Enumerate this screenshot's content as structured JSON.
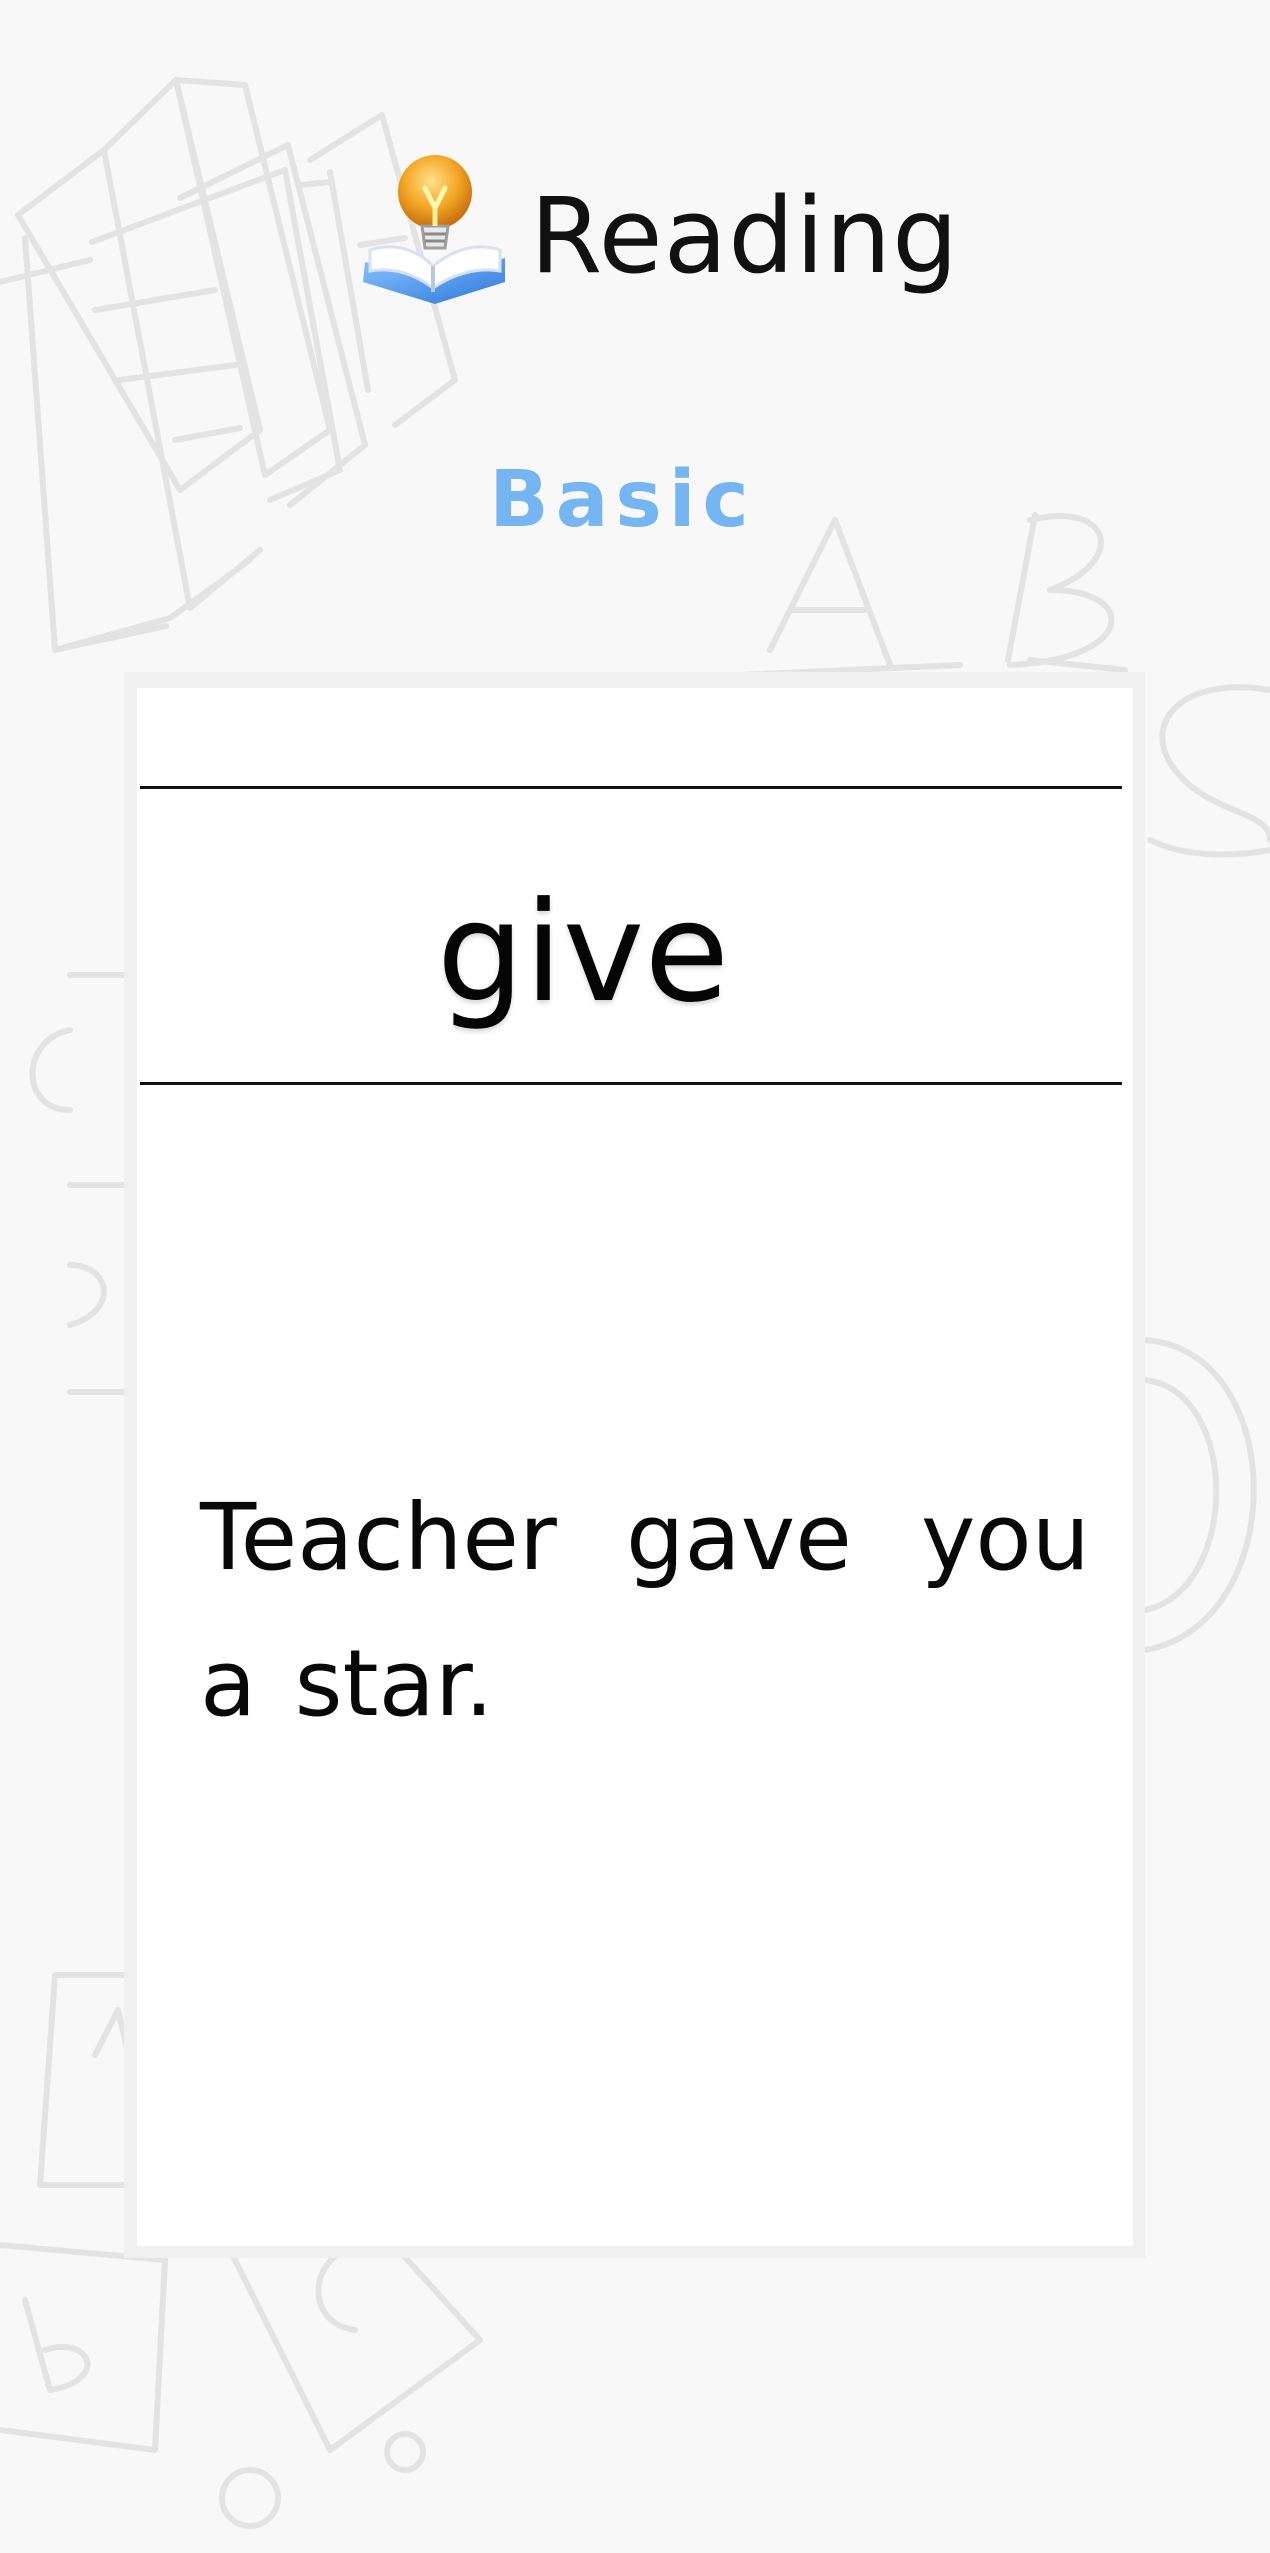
{
  "header": {
    "logo_icon": "book-lightbulb-icon",
    "title": "Reading",
    "level": "Basic"
  },
  "card": {
    "word": "give",
    "sentence": "Teacher gave you a star."
  },
  "colors": {
    "background": "#f8f8f8",
    "level": "#74b5f2",
    "card": "#ffffff",
    "text": "#111111"
  }
}
